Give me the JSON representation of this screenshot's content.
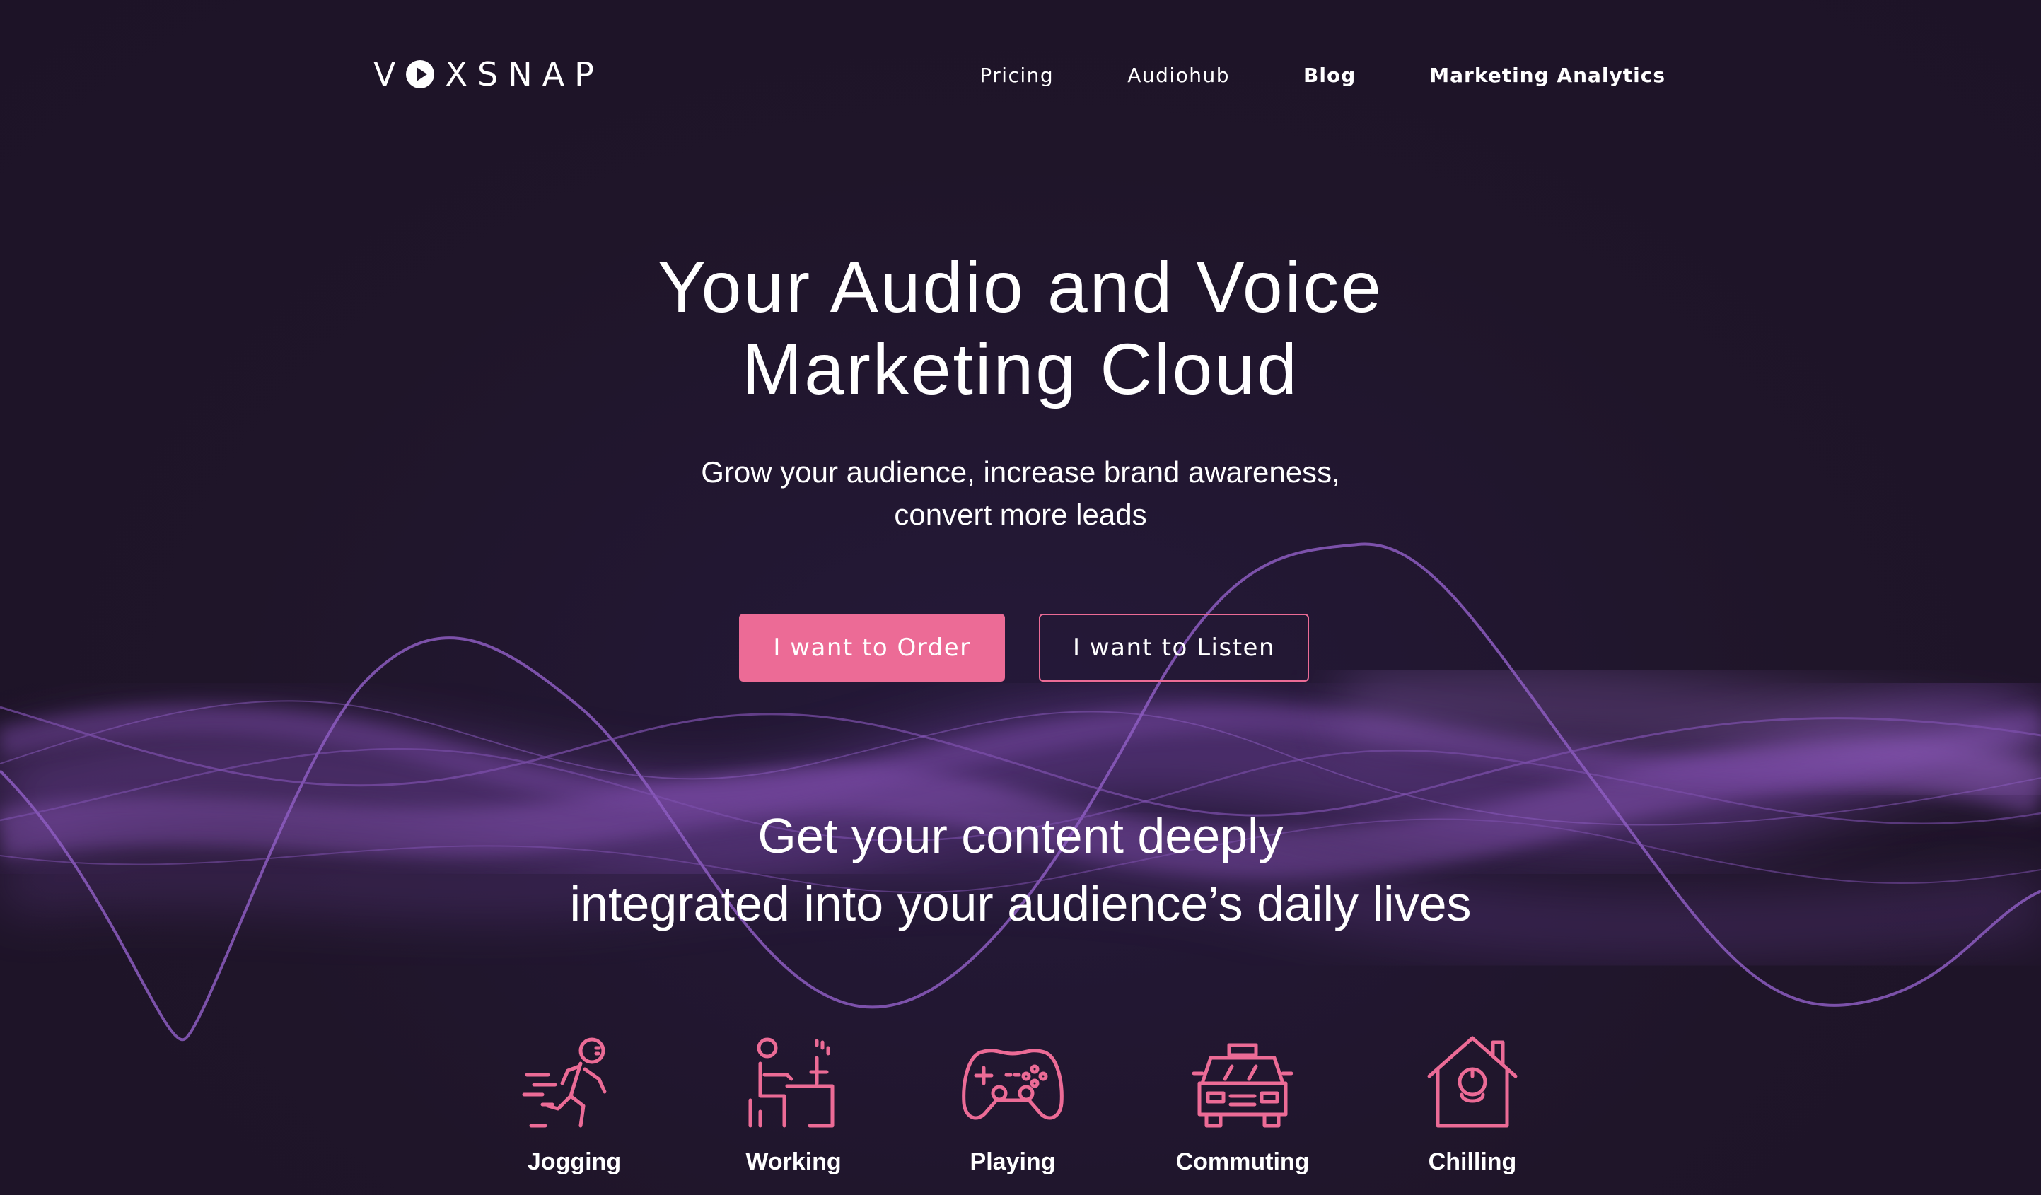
{
  "brand": {
    "logo_letters": [
      "V",
      "X",
      "S",
      "N",
      "A",
      "P"
    ],
    "logo_icon": "play-circle-icon",
    "accent_color": "#ec6b96",
    "background_color": "#1f1529",
    "wave_color": "#7a4aa8"
  },
  "nav": {
    "items": [
      {
        "label": "Pricing"
      },
      {
        "label": "Audiohub"
      },
      {
        "label": "Blog"
      },
      {
        "label": "Marketing Analytics"
      }
    ]
  },
  "hero": {
    "title_line1": "Your Audio and Voice",
    "title_line2": "Marketing Cloud",
    "subtitle_line1": "Grow your audience, increase brand awareness,",
    "subtitle_line2": "convert more leads",
    "order_button": "I want to Order",
    "listen_button": "I want to Listen"
  },
  "section": {
    "title_line1": "Get your content deeply",
    "title_line2": "integrated into your audience’s daily lives"
  },
  "activities": [
    {
      "label": "Jogging",
      "icon": "jogging-icon"
    },
    {
      "label": "Working",
      "icon": "working-icon"
    },
    {
      "label": "Playing",
      "icon": "gamepad-icon"
    },
    {
      "label": "Commuting",
      "icon": "taxi-icon"
    },
    {
      "label": "Chilling",
      "icon": "home-icon"
    }
  ]
}
